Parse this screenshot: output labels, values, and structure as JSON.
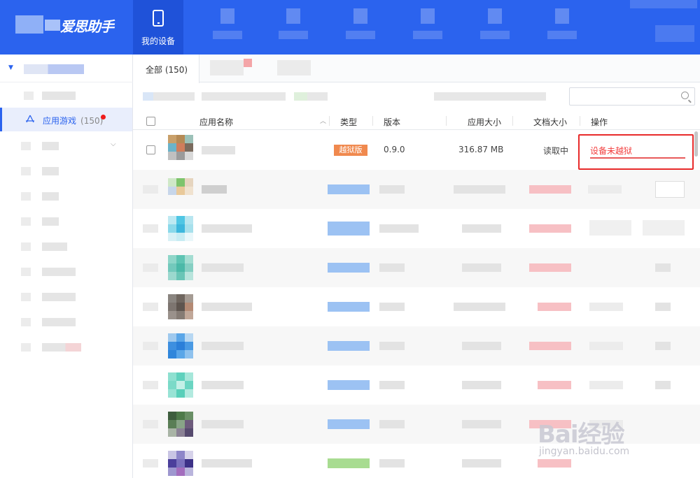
{
  "header": {
    "logo_text": "爱思助手",
    "nav_active_label": "我的设备"
  },
  "sidebar": {
    "active_item": {
      "label": "应用游戏",
      "count": "(150)"
    }
  },
  "tabs": [
    {
      "label": "全部 (150)"
    }
  ],
  "search": {
    "placeholder": ""
  },
  "table": {
    "headers": {
      "name": "应用名称",
      "type": "类型",
      "version": "版本",
      "app_size": "应用大小",
      "doc_size": "文档大小",
      "action": "操作"
    },
    "first_row": {
      "type_tag": "越狱版",
      "version": "0.9.0",
      "app_size": "316.87 MB",
      "doc_size": "读取中",
      "action": "设备未越狱"
    }
  },
  "watermark": {
    "text": "Bai经验",
    "url": "jingyan.baidu.com"
  },
  "colors": {
    "brand": "#2b63ee",
    "accent_red": "#f01b1b",
    "tag_orange": "#f0894e"
  },
  "icons": [
    "phone-icon",
    "app-store-icon",
    "search-icon",
    "chevron-down-icon",
    "sort-up-icon"
  ]
}
